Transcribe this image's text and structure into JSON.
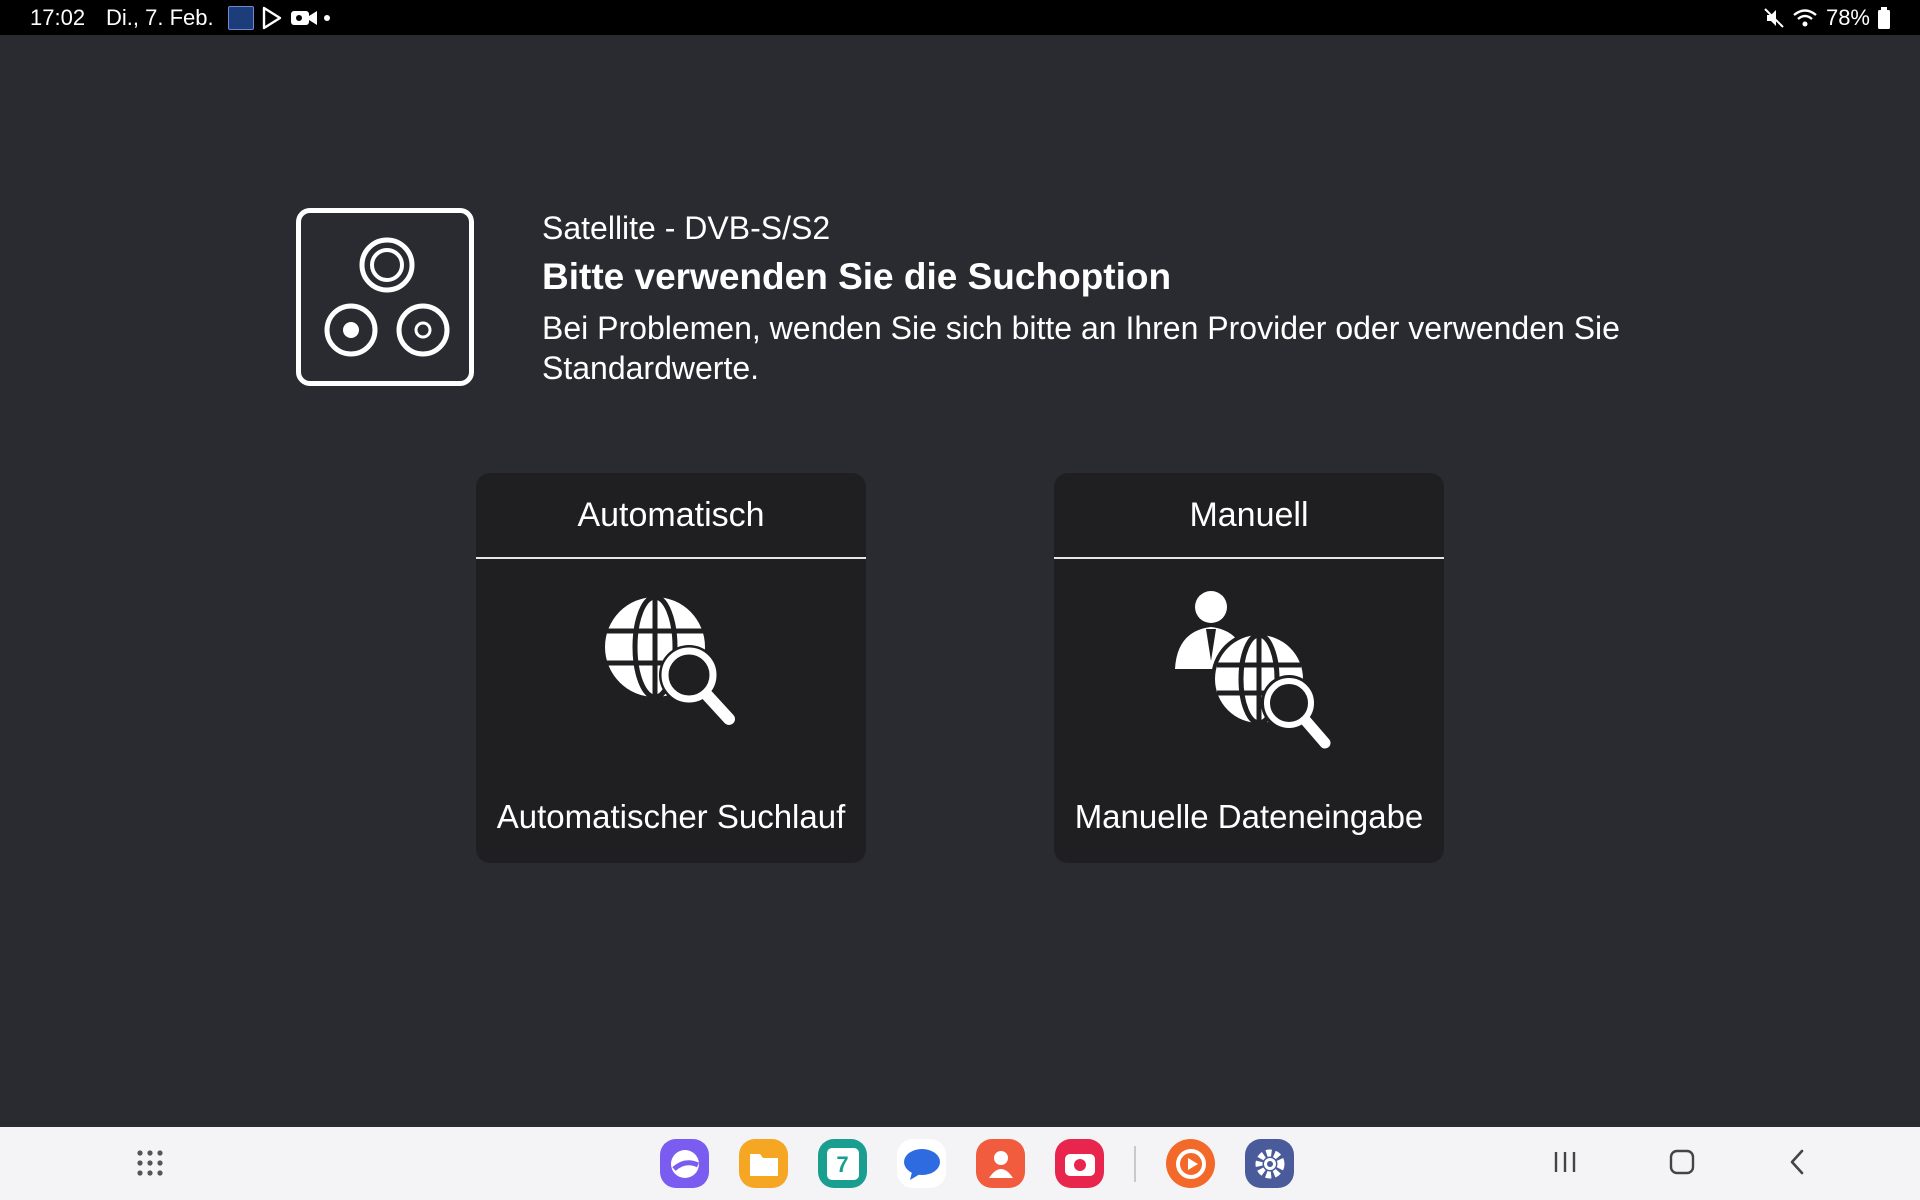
{
  "status_bar": {
    "time": "17:02",
    "date": "Di., 7. Feb.",
    "battery": "78%"
  },
  "header": {
    "source": "Satellite - DVB-S/S2",
    "title": "Bitte verwenden Sie die Suchoption",
    "description": "Bei Problemen, wenden Sie sich bitte an Ihren Provider oder verwenden Sie Standardwerte."
  },
  "options": {
    "automatic": {
      "heading": "Automatisch",
      "label": "Automatischer Suchlauf",
      "icon": "globe-search-icon"
    },
    "manual": {
      "heading": "Manuell",
      "label": "Manuelle Dateneingabe",
      "icon": "person-globe-search-icon"
    }
  },
  "taskbar": {
    "dock": [
      {
        "name": "internet-app-icon",
        "color": "#7b5cf0"
      },
      {
        "name": "my-files-app-icon",
        "color": "#f5a623"
      },
      {
        "name": "calendar-app-icon",
        "color": "#1a9e8f",
        "text": "7"
      },
      {
        "name": "messages-app-icon",
        "color": "#2f6be0"
      },
      {
        "name": "contacts-app-icon",
        "color": "#f25c3e"
      },
      {
        "name": "screen-recorder-app-icon",
        "color": "#e8254c"
      },
      {
        "name": "video-app-icon",
        "color": "#f2692a"
      },
      {
        "name": "settings-app-icon",
        "color": "#4a5b9c"
      }
    ]
  }
}
